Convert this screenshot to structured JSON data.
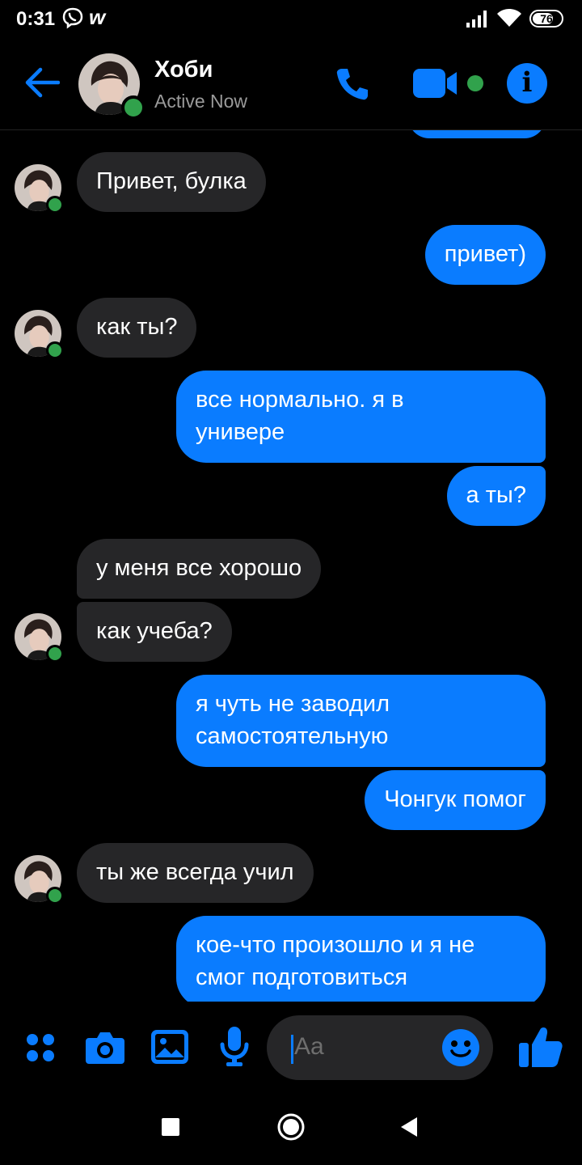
{
  "status_bar": {
    "time": "0:31",
    "battery": "76",
    "battery_level": 0.76
  },
  "header": {
    "contact_name": "Хоби",
    "contact_status": "Active Now"
  },
  "messages": [
    {
      "side": "in",
      "text": "Привет, булка"
    },
    {
      "side": "out",
      "text": "привет)"
    },
    {
      "side": "in",
      "text": "как ты?"
    },
    {
      "side": "out",
      "text": "все нормально. я в\nунивере"
    },
    {
      "side": "out",
      "text": "а ты?"
    },
    {
      "side": "in",
      "text": "у меня все хорошо"
    },
    {
      "side": "in",
      "text": "как учеба?"
    },
    {
      "side": "out",
      "text": "я чуть не заводил\nсамостоятельную"
    },
    {
      "side": "out",
      "text": "Чонгук помог"
    },
    {
      "side": "in",
      "text": "ты же всегда учил"
    },
    {
      "side": "out",
      "text": "кое-что произошло и я не\nсмог подготовиться"
    }
  ],
  "composer": {
    "placeholder": "Aa"
  },
  "colors": {
    "accent": "#0a7cff",
    "incoming_bubble": "#262628",
    "online": "#31a24c",
    "background": "#000000"
  },
  "icons": {
    "header": [
      "back-arrow-icon",
      "phone-icon",
      "video-camera-icon",
      "info-icon"
    ],
    "composer": [
      "menu-dots-icon",
      "camera-icon",
      "image-icon",
      "microphone-icon",
      "emoji-icon",
      "thumbs-up-icon"
    ],
    "navbar": [
      "recent-apps-icon",
      "home-icon",
      "back-icon"
    ]
  }
}
